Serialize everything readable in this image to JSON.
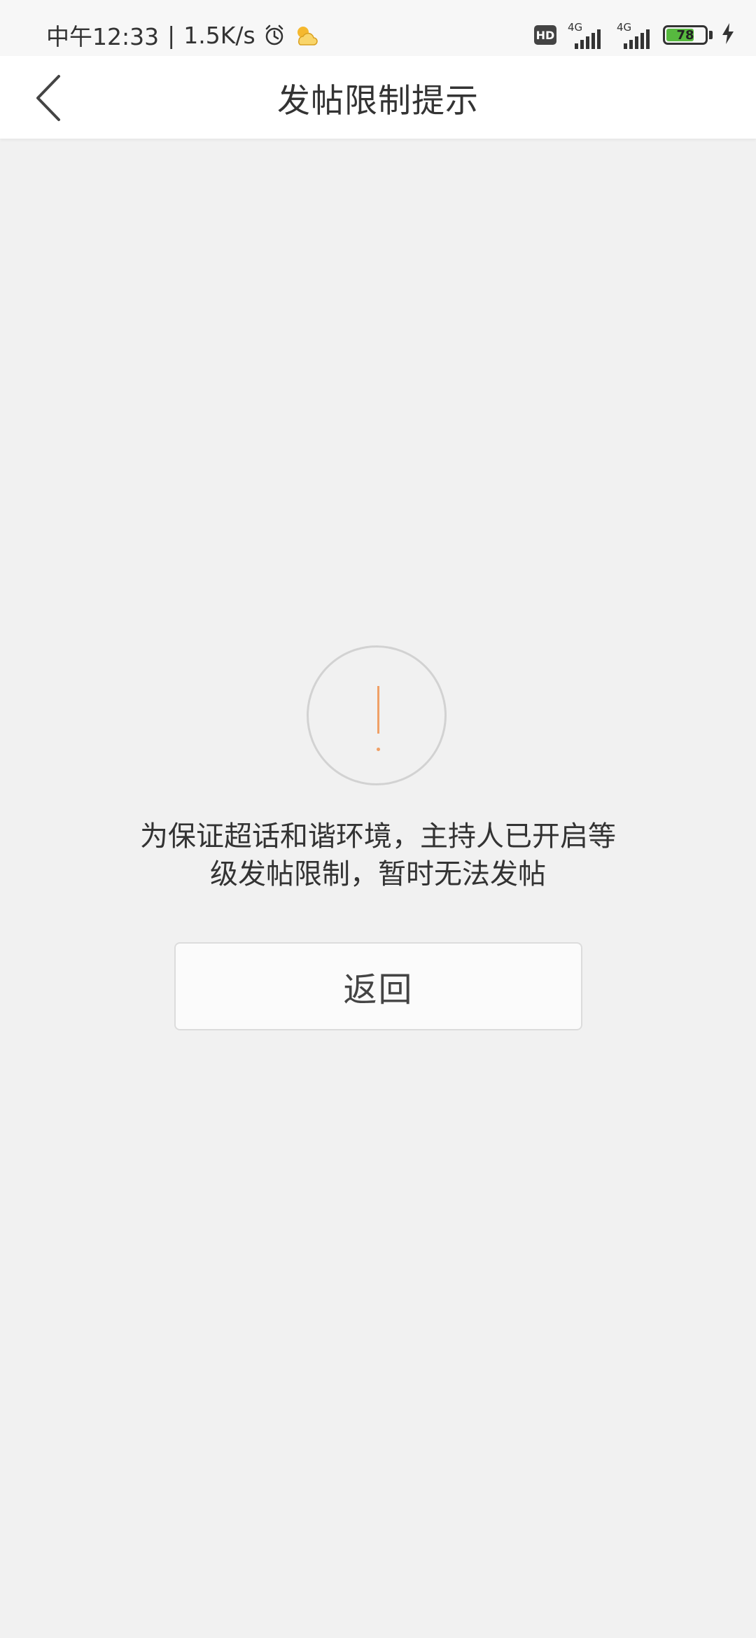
{
  "status_bar": {
    "time": "中午12:33",
    "separator": "|",
    "speed": "1.5K/s",
    "alarm_icon": "alarm-clock-icon",
    "weather_icon": "weather-sun-cloud-icon",
    "hd_label": "HD",
    "signal1_label": "4G",
    "signal2_label": "4G",
    "battery_level": "78",
    "battery_fraction": 0.78,
    "charging_icon": "charging-bolt-icon",
    "battery_color": "#57b93f"
  },
  "nav": {
    "title": "发帖限制提示",
    "back_icon": "chevron-left-icon"
  },
  "notice": {
    "icon": "exclamation-circle-icon",
    "icon_color": "#f0a066",
    "message_line1": "为保证超话和谐环境，主持人已开启等",
    "message_line2": "级发帖限制，暂时无法发帖"
  },
  "actions": {
    "return_label": "返回"
  }
}
